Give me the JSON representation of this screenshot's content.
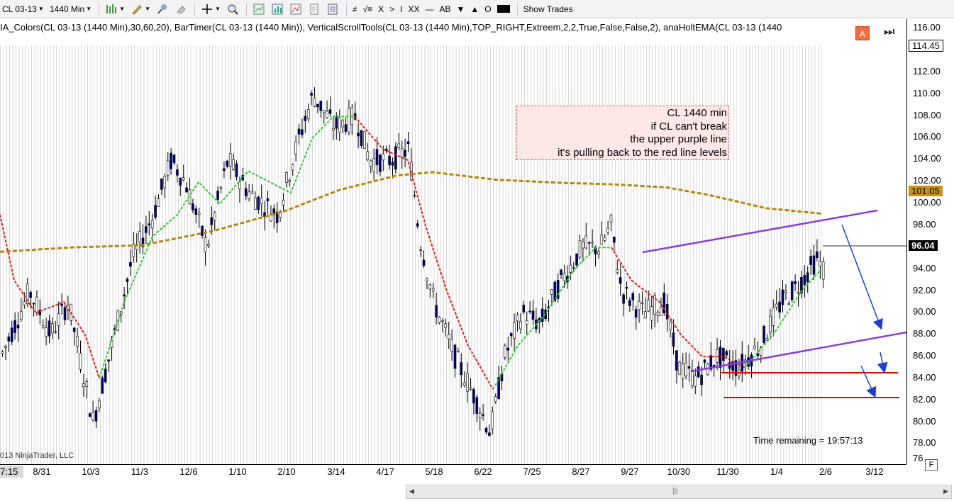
{
  "toolbar": {
    "instrument": "CL 03-13",
    "period": "1440 Min",
    "show_trades": "Show Trades",
    "draw_tools": [
      "≠",
      "√≡",
      "X",
      ">",
      "I",
      "XX",
      "—",
      "AB",
      "▼",
      "▲",
      "O"
    ]
  },
  "indicators_text": "IA_Colors(CL 03-13 (1440 Min),30,60,20),  BarTimer(CL 03-13 (1440 Min)),  VerticalScrollTools(CL 03-13 (1440 Min),TOP_RIGHT,Extreem,2,2,True,False,False,2),  anaHoltEMA(CL 03-13 (1440",
  "annotation": [
    "CL 1440 min",
    "if CL can't break",
    "the upper purple line",
    "it's pulling back to the red line levels"
  ],
  "time_remaining": "Time remaining = 19:57:13",
  "copyright": "013 NinjaTrader, LLC",
  "buttons": {
    "a": "A",
    "f": "F"
  },
  "y_axis": {
    "ticks": [
      "116.00",
      "114.45",
      "112.00",
      "110.00",
      "108.00",
      "106.00",
      "104.00",
      "102.00",
      "101.05",
      "100.00",
      "98.00",
      "96.04",
      "94.00",
      "92.00",
      "90.00",
      "88.00",
      "86.00",
      "84.00",
      "82.00",
      "80.00",
      "78.00",
      "76"
    ],
    "current_price": "96.04",
    "ema_price": "101.05",
    "high_price": "114.45"
  },
  "x_axis": {
    "corner": "7:15",
    "ticks": [
      "8/31",
      "10/3",
      "11/3",
      "12/6",
      "1/10",
      "2/10",
      "3/14",
      "4/17",
      "5/18",
      "6/22",
      "7/25",
      "8/27",
      "9/27",
      "10/30",
      "11/30",
      "1/4",
      "2/6",
      "3/12"
    ]
  },
  "colors": {
    "bull_candle": "#ffffff",
    "bear_candle": "#000080",
    "ema_fast_up": "#2ecc2e",
    "ema_fast_down": "#e01e1e",
    "ema_slow": "#b8860b",
    "trendline": "#8e3bd8",
    "support": "#e00000",
    "arrow": "#1a3fd6"
  }
}
